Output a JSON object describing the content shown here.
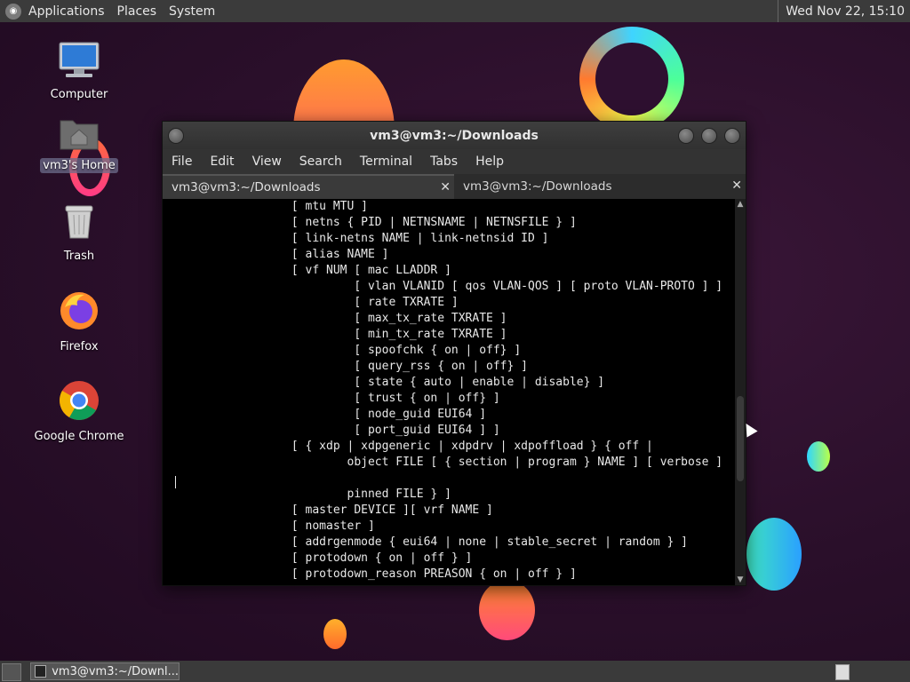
{
  "top_panel": {
    "menus": [
      "Applications",
      "Places",
      "System"
    ],
    "clock": "Wed Nov 22, 15:10"
  },
  "desktop_icons": [
    {
      "label": "Computer",
      "icon": "computer-icon"
    },
    {
      "label": "vm3's Home",
      "icon": "home-folder-icon",
      "selected": true
    },
    {
      "label": "Trash",
      "icon": "trash-icon"
    },
    {
      "label": "Firefox",
      "icon": "firefox-icon"
    },
    {
      "label": "Google Chrome",
      "icon": "chrome-icon"
    }
  ],
  "window": {
    "title": "vm3@vm3:~/Downloads",
    "menus": [
      "File",
      "Edit",
      "View",
      "Search",
      "Terminal",
      "Tabs",
      "Help"
    ],
    "tabs": [
      {
        "label": "vm3@vm3:~/Downloads",
        "active": true
      },
      {
        "label": "vm3@vm3:~/Downloads",
        "active": false
      }
    ],
    "terminal_lines": [
      "                  [ mtu MTU ]",
      "                  [ netns { PID | NETNSNAME | NETNSFILE } ]",
      "                  [ link-netns NAME | link-netnsid ID ]",
      "                  [ alias NAME ]",
      "                  [ vf NUM [ mac LLADDR ]",
      "                           [ vlan VLANID [ qos VLAN-QOS ] [ proto VLAN-PROTO ] ]",
      "                           [ rate TXRATE ]",
      "                           [ max_tx_rate TXRATE ]",
      "                           [ min_tx_rate TXRATE ]",
      "                           [ spoofchk { on | off} ]",
      "                           [ query_rss { on | off} ]",
      "                           [ state { auto | enable | disable} ]",
      "                           [ trust { on | off} ]",
      "                           [ node_guid EUI64 ]",
      "                           [ port_guid EUI64 ] ]",
      "                  [ { xdp | xdpgeneric | xdpdrv | xdpoffload } { off |",
      "                          object FILE [ { section | program } NAME ] [ verbose ]",
      "",
      "                          pinned FILE } ]",
      "                  [ master DEVICE ][ vrf NAME ]",
      "                  [ nomaster ]",
      "                  [ addrgenmode { eui64 | none | stable_secret | random } ]",
      "                  [ protodown { on | off } ]",
      "                  [ protodown_reason PREASON { on | off } ]"
    ]
  },
  "taskbar": {
    "task_label": "vm3@vm3:~/Downl..."
  }
}
